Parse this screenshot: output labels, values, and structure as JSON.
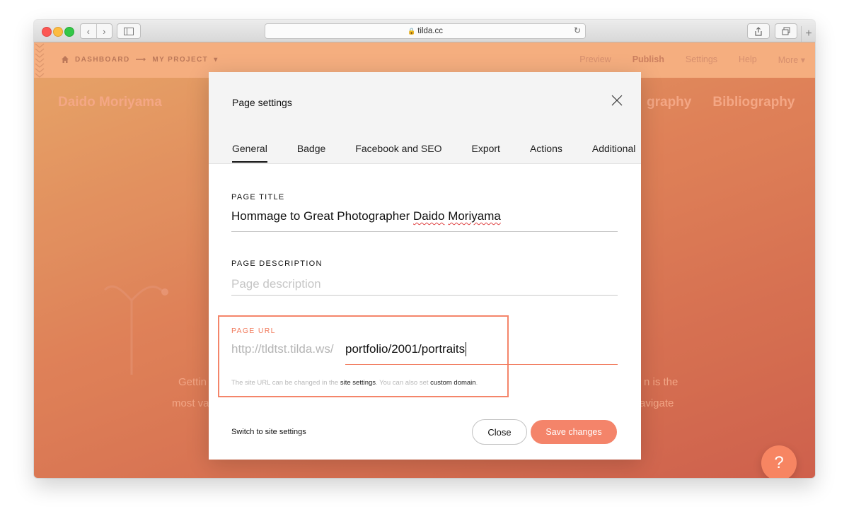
{
  "browser": {
    "address": "tilda.cc"
  },
  "topbar": {
    "breadcrumb": [
      "DASHBOARD",
      "MY PROJECT"
    ],
    "nav": [
      "Preview",
      "Publish",
      "Settings",
      "Help",
      "More"
    ]
  },
  "site": {
    "title": "Daido Moriyama",
    "nav": [
      "graphy",
      "Bibliography"
    ],
    "bg_text_left": [
      "Gettin",
      "most va"
    ],
    "bg_text_right": [
      "n is the",
      "avigate"
    ]
  },
  "modal": {
    "title": "Page settings",
    "tabs": [
      {
        "label": "General",
        "active": true
      },
      {
        "label": "Badge",
        "active": false
      },
      {
        "label": "Facebook and SEO",
        "active": false
      },
      {
        "label": "Export",
        "active": false
      },
      {
        "label": "Actions",
        "active": false
      },
      {
        "label": "Additional",
        "active": false
      }
    ],
    "page_title": {
      "label": "PAGE TITLE",
      "value_plain": "Hommage to Great Photographer ",
      "value_spell_1": "Daido",
      "value_space": " ",
      "value_spell_2": "Moriyama"
    },
    "page_description": {
      "label": "PAGE DESCRIPTION",
      "value": "",
      "placeholder": "Page description"
    },
    "page_url": {
      "label": "PAGE URL",
      "prefix": "http://tldtst.tilda.ws/",
      "value": "portfolio/2001/portraits",
      "hint_1": "The site URL can be changed in the ",
      "hint_link_1": "site settings",
      "hint_2": ". You can also set ",
      "hint_link_2": "custom domain",
      "hint_3": "."
    },
    "switch_link": "Switch to site settings",
    "close_label": "Close",
    "save_label": "Save changes"
  },
  "help": {
    "label": "?"
  },
  "colors": {
    "accent": "#f4846a",
    "topbar": "#f5a978",
    "background": "#dd7a4e"
  }
}
